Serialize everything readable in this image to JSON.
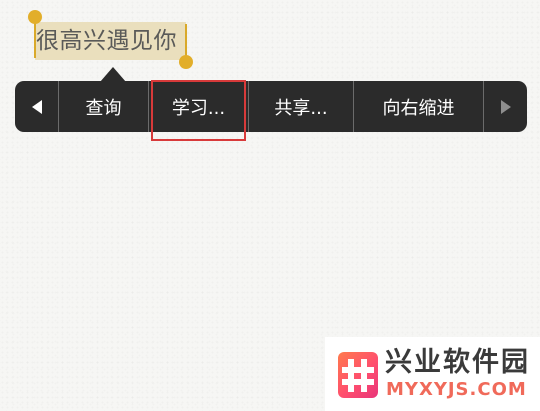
{
  "selection": {
    "text": "很高兴遇见你"
  },
  "menu": {
    "items": [
      {
        "id": "prev",
        "icon": "chevron-left-icon"
      },
      {
        "id": "lookup",
        "label": "查询"
      },
      {
        "id": "learn",
        "label": "学习..."
      },
      {
        "id": "share",
        "label": "共享..."
      },
      {
        "id": "indent",
        "label": "向右缩进"
      },
      {
        "id": "next",
        "icon": "chevron-right-icon"
      }
    ]
  },
  "highlight": {
    "target": "learn",
    "color": "#d83a3a"
  },
  "watermark": {
    "title": "兴业软件园",
    "url": "MYXYJS.COM",
    "logo_icon": "hash-logo-icon"
  },
  "colors": {
    "selection_background": "#eadfbd",
    "handle": "#e2ae2a",
    "menu_background": "#2b2b2b",
    "menu_text": "#ffffff"
  }
}
